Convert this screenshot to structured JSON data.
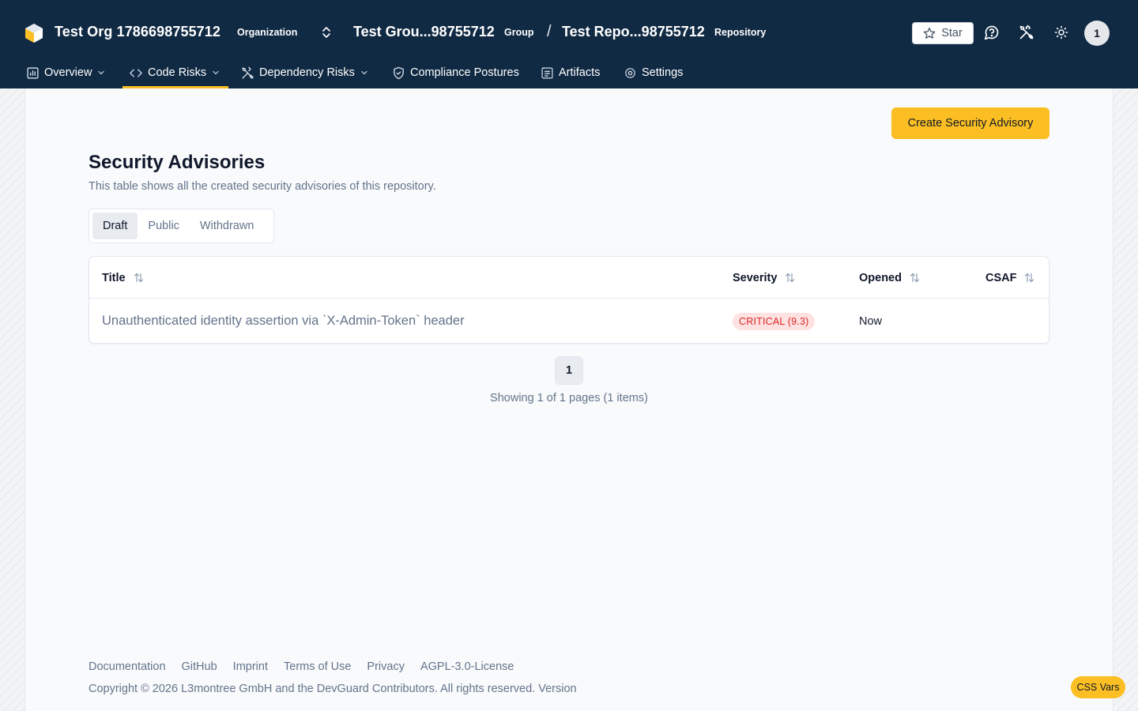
{
  "header": {
    "org": {
      "name": "Test Org 1786698755712",
      "tag": "Organization"
    },
    "group": {
      "name": "Test Grou...98755712",
      "tag": "Group"
    },
    "separator": "/",
    "repo": {
      "name": "Test Repo...98755712",
      "tag": "Repository"
    },
    "star_label": "Star",
    "avatar_initial": "1"
  },
  "nav": {
    "items": [
      {
        "label": "Overview",
        "icon": "chart-icon",
        "dropdown": true
      },
      {
        "label": "Code Risks",
        "icon": "code-icon",
        "dropdown": true,
        "active": true
      },
      {
        "label": "Dependency Risks",
        "icon": "tools-icon",
        "dropdown": true
      },
      {
        "label": "Compliance Postures",
        "icon": "shield-icon"
      },
      {
        "label": "Artifacts",
        "icon": "list-icon"
      },
      {
        "label": "Settings",
        "icon": "gear-icon"
      }
    ]
  },
  "main": {
    "create_button": "Create Security Advisory",
    "title": "Security Advisories",
    "description": "This table shows all the created security advisories of this repository.",
    "tabs": [
      {
        "label": "Draft",
        "active": true
      },
      {
        "label": "Public"
      },
      {
        "label": "Withdrawn"
      }
    ],
    "table": {
      "columns": [
        "Title",
        "Severity",
        "Opened",
        "CSAF"
      ],
      "rows": [
        {
          "title": "Unauthenticated identity assertion via `X-Admin-Token` header",
          "severity": "CRITICAL (9.3)",
          "opened": "Now",
          "csaf": ""
        }
      ]
    },
    "pagination": {
      "current_page": "1",
      "summary": "Showing 1 of 1 pages (1 items)"
    }
  },
  "footer": {
    "links": [
      "Documentation",
      "GitHub",
      "Imprint",
      "Terms of Use",
      "Privacy",
      "AGPL-3.0-License"
    ],
    "copyright": "Copyright © 2026 L3montree GmbH and the DevGuard Contributors. All rights reserved. Version"
  },
  "css_vars_button": "CSS Vars",
  "colors": {
    "header_bg": "#102a43",
    "accent": "#fbbf24",
    "page_bg": "#f8fafc",
    "critical_bg": "#fee2e2",
    "critical_text": "#dc2626"
  }
}
